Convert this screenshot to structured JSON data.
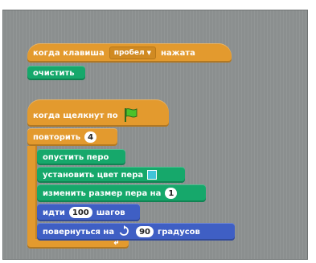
{
  "script1": {
    "hat_label": "когда клавиша",
    "key_value": "пробел",
    "hat_suffix": "нажата",
    "clear_label": "очистить"
  },
  "script2": {
    "hat_label": "когда щелкнут по",
    "flag_icon": "green-flag-icon",
    "repeat_label": "повторить",
    "repeat_count": "4",
    "pen_down_label": "опустить перо",
    "set_color_label": "установить цвет пера",
    "pen_color": "#3fc4d8",
    "change_size_label": "изменить размер пера на",
    "change_size_value": "1",
    "move_label": "идти",
    "move_steps": "100",
    "move_suffix": "шагов",
    "turn_label": "повернуться на",
    "turn_icon": "rotate-clockwise-icon",
    "turn_degrees": "90",
    "turn_suffix": "градусов",
    "loop_arrow_icon": "loop-arrow-icon"
  },
  "colors": {
    "events": "#e39a2e",
    "pen": "#16a86b",
    "motion": "#3f5fc4",
    "workspace": "#8b8f8f"
  }
}
